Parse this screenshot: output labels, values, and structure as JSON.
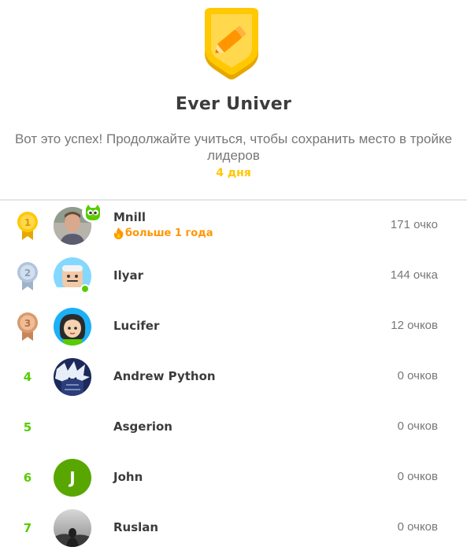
{
  "header": {
    "league_title": "Ever Univer",
    "message": "Вот это успех! Продолжайте учиться, чтобы сохранить место в тройке лидеров",
    "time_left": "4 дня",
    "badge_icon": "pencil-icon",
    "badge_color": "#ffc800"
  },
  "colors": {
    "rank_number": "#58cc02",
    "streak": "#ff9600",
    "gold": "#ffc800",
    "silver": "#b0c4de",
    "bronze": "#d99a6c"
  },
  "leaderboard": [
    {
      "rank": "1",
      "medal": "gold",
      "name": "Mnill",
      "streak": "больше 1 года",
      "score": "171 очко",
      "avatar": "photo",
      "badge": "duo-owl-icon"
    },
    {
      "rank": "2",
      "medal": "silver",
      "name": "Ilyar",
      "score": "144 очка",
      "avatar": "cartoon",
      "online": true
    },
    {
      "rank": "3",
      "medal": "bronze",
      "name": "Lucifer",
      "score": "12 очков",
      "avatar": "cartoon"
    },
    {
      "rank": "4",
      "name": "Andrew Python",
      "score": "0 очков",
      "avatar": "image"
    },
    {
      "rank": "5",
      "name": "Asgerion",
      "score": "0 очков",
      "avatar": "none"
    },
    {
      "rank": "6",
      "name": "John",
      "score": "0 очков",
      "avatar": "letter",
      "avatar_letter": "J",
      "avatar_color": "#58a700"
    },
    {
      "rank": "7",
      "name": "Ruslan",
      "score": "0 очков",
      "avatar": "photo"
    }
  ]
}
